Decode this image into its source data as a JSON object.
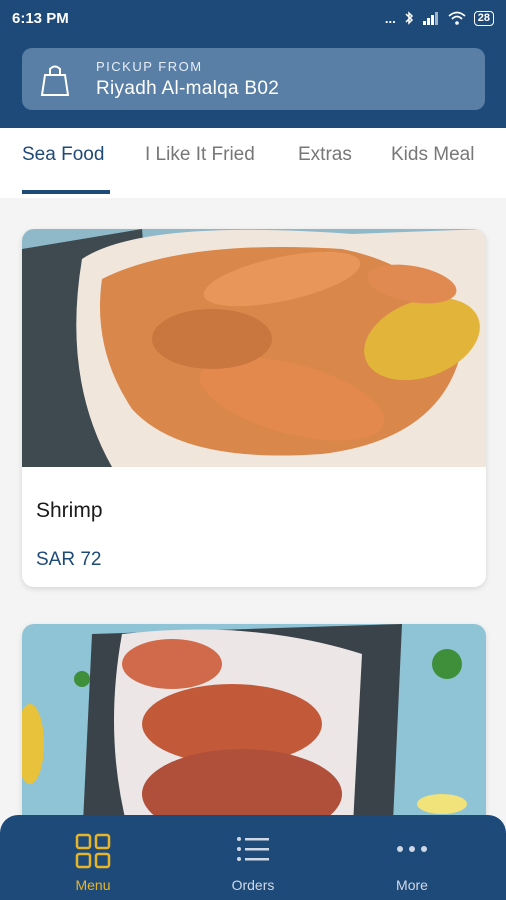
{
  "status": {
    "time": "6:13 PM",
    "battery": "28",
    "signal_dots": "..."
  },
  "pickup": {
    "label": "PICKUP FROM",
    "location": "Riyadh  Al-malqa B02"
  },
  "tabs": [
    {
      "label": "Sea Food"
    },
    {
      "label": "I Like It Fried"
    },
    {
      "label": "Extras"
    },
    {
      "label": "Kids Meal"
    }
  ],
  "active_tab": "Sea Food",
  "items": [
    {
      "name": "Shrimp",
      "price": "SAR 72"
    }
  ],
  "nav": [
    {
      "label": "Menu",
      "icon": "grid-icon"
    },
    {
      "label": "Orders",
      "icon": "list-icon"
    },
    {
      "label": "More",
      "icon": "more-dots-icon"
    }
  ],
  "colors": {
    "brand": "#1e4a7a",
    "accent": "#e8b52a"
  }
}
